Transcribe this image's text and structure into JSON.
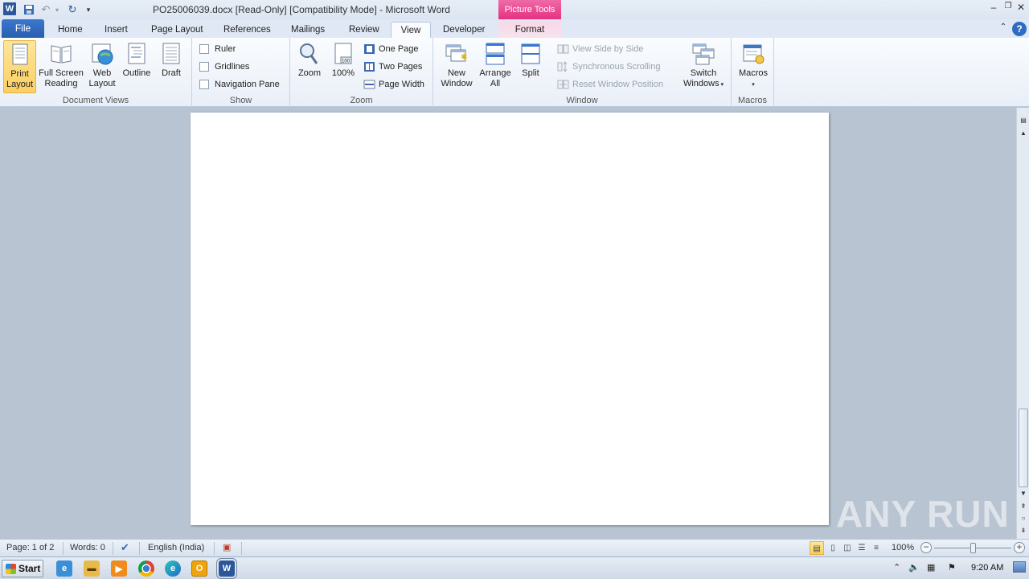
{
  "titlebar": {
    "title": "PO25006039.docx [Read-Only] [Compatibility Mode] - Microsoft Word",
    "contextual_tab_group": "Picture Tools",
    "app_icon_letter": "W"
  },
  "tabs": {
    "file": "File",
    "home": "Home",
    "insert": "Insert",
    "page_layout": "Page Layout",
    "references": "References",
    "mailings": "Mailings",
    "review": "Review",
    "view": "View",
    "developer": "Developer",
    "format": "Format"
  },
  "ribbon": {
    "document_views": {
      "label": "Document Views",
      "print_layout_1": "Print",
      "print_layout_2": "Layout",
      "full_screen_1": "Full Screen",
      "full_screen_2": "Reading",
      "web_layout_1": "Web",
      "web_layout_2": "Layout",
      "outline": "Outline",
      "draft": "Draft"
    },
    "show": {
      "label": "Show",
      "ruler": "Ruler",
      "gridlines": "Gridlines",
      "navigation_pane": "Navigation Pane"
    },
    "zoom": {
      "label": "Zoom",
      "zoom": "Zoom",
      "hundred": "100%",
      "one_page": "One Page",
      "two_pages": "Two Pages",
      "page_width": "Page Width"
    },
    "window": {
      "label": "Window",
      "new_window_1": "New",
      "new_window_2": "Window",
      "arrange_all_1": "Arrange",
      "arrange_all_2": "All",
      "split": "Split",
      "view_side_by_side": "View Side by Side",
      "synchronous_scrolling": "Synchronous Scrolling",
      "reset_window_position": "Reset Window Position",
      "switch_windows_1": "Switch",
      "switch_windows_2": "Windows"
    },
    "macros": {
      "label": "Macros",
      "macros": "Macros"
    }
  },
  "statusbar": {
    "page": "Page: 1 of 2",
    "words": "Words: 0",
    "language": "English (India)",
    "zoom_level": "100%",
    "zoom_fraction": 0.5
  },
  "watermark": "ANY RUN",
  "taskbar": {
    "start": "Start",
    "clock": "9:20 AM"
  }
}
